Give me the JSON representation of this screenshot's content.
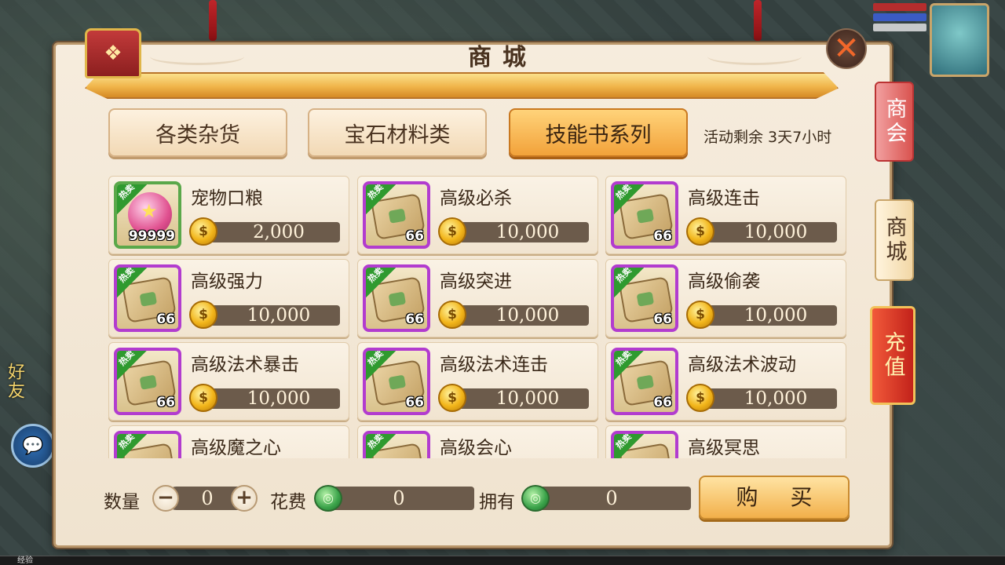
{
  "window": {
    "title": "商城"
  },
  "tabs": [
    {
      "label": "各类杂货",
      "active": false
    },
    {
      "label": "宝石材料类",
      "active": false
    },
    {
      "label": "技能书系列",
      "active": true
    }
  ],
  "countdown": "活动剩余 3天7小时",
  "hot_badge": "热卖",
  "items": [
    {
      "name": "宠物口粮",
      "price": "2,000",
      "count": "99999",
      "icon": "pet-food-orb-icon",
      "frame": "green"
    },
    {
      "name": "高级必杀",
      "price": "10,000",
      "count": "66",
      "icon": "skill-book-scroll-icon",
      "frame": "purple"
    },
    {
      "name": "高级连击",
      "price": "10,000",
      "count": "66",
      "icon": "skill-book-scroll-icon",
      "frame": "purple"
    },
    {
      "name": "高级强力",
      "price": "10,000",
      "count": "66",
      "icon": "skill-book-scroll-icon",
      "frame": "purple"
    },
    {
      "name": "高级突进",
      "price": "10,000",
      "count": "66",
      "icon": "skill-book-scroll-icon",
      "frame": "purple"
    },
    {
      "name": "高级偷袭",
      "price": "10,000",
      "count": "66",
      "icon": "skill-book-scroll-icon",
      "frame": "purple"
    },
    {
      "name": "高级法术暴击",
      "price": "10,000",
      "count": "66",
      "icon": "skill-book-scroll-icon",
      "frame": "purple"
    },
    {
      "name": "高级法术连击",
      "price": "10,000",
      "count": "66",
      "icon": "skill-book-scroll-icon",
      "frame": "purple"
    },
    {
      "name": "高级法术波动",
      "price": "10,000",
      "count": "66",
      "icon": "skill-book-scroll-icon",
      "frame": "purple"
    },
    {
      "name": "高级魔之心",
      "price": "",
      "count": "",
      "icon": "skill-book-scroll-icon",
      "frame": "purple"
    },
    {
      "name": "高级会心",
      "price": "",
      "count": "",
      "icon": "skill-book-scroll-icon",
      "frame": "purple"
    },
    {
      "name": "高级冥思",
      "price": "",
      "count": "",
      "icon": "skill-book-scroll-icon",
      "frame": "purple"
    }
  ],
  "purchase": {
    "qty_label": "数量",
    "qty_value": "0",
    "cost_label": "花费",
    "cost_value": "0",
    "own_label": "拥有",
    "own_value": "0",
    "buy_label": "购 买"
  },
  "side_tabs": {
    "guild": "商会",
    "shop": "商城",
    "recharge": "充值"
  },
  "hud": {
    "friends": "好友",
    "exp": "经验"
  },
  "colors": {
    "accent": "#f2a23a",
    "hot_badge": "#2f9a2f",
    "rare_frame": "#b23ccf",
    "common_frame": "#5aa84a"
  }
}
